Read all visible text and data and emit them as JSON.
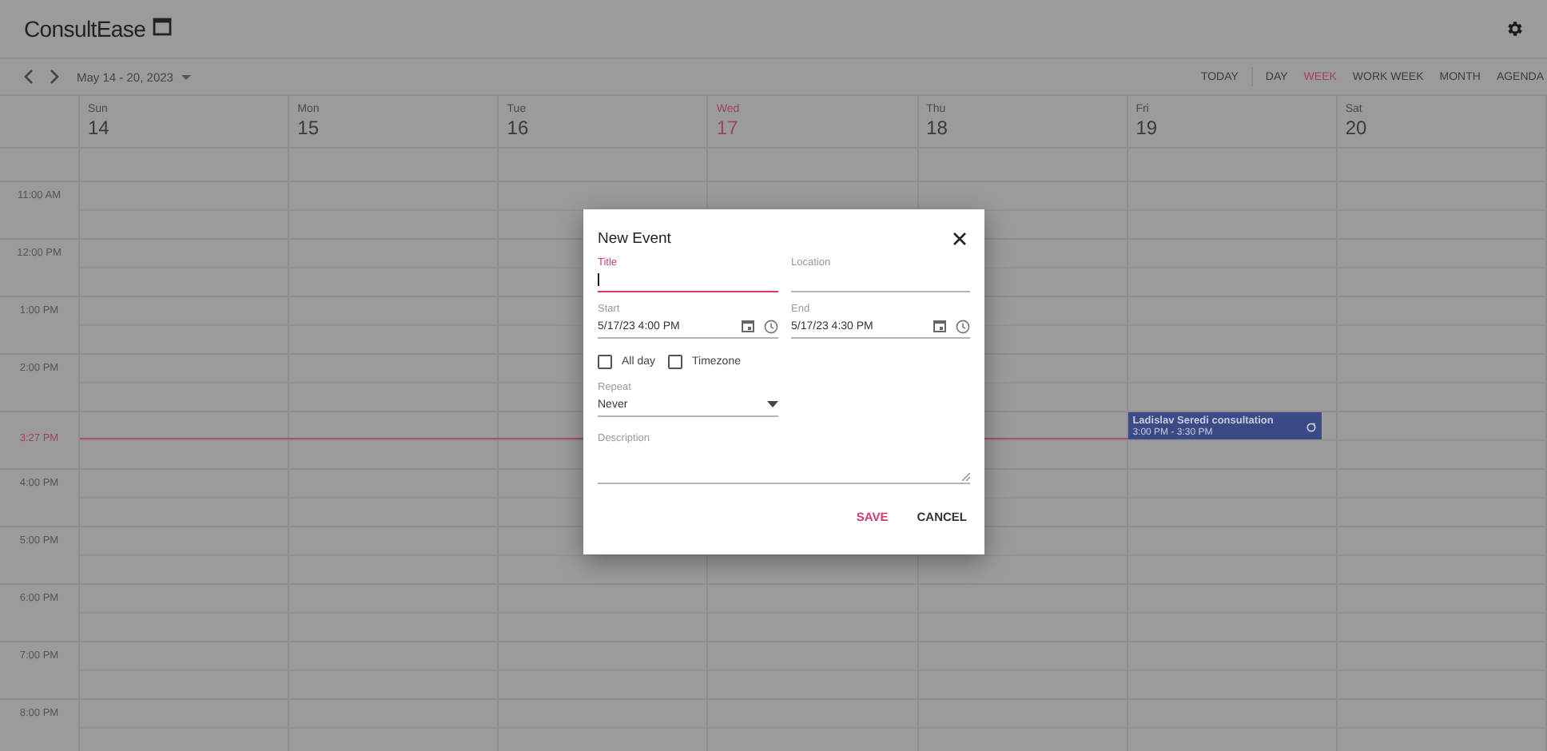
{
  "app": {
    "title": "ConsultEase"
  },
  "toolbar": {
    "range": "May 14 - 20, 2023",
    "today": "TODAY",
    "views": [
      {
        "label": "DAY",
        "selected": false
      },
      {
        "label": "WEEK",
        "selected": true
      },
      {
        "label": "WORK WEEK",
        "selected": false
      },
      {
        "label": "MONTH",
        "selected": false
      },
      {
        "label": "AGENDA",
        "selected": false
      }
    ]
  },
  "days": [
    {
      "name": "Sun",
      "date": "14",
      "today": false
    },
    {
      "name": "Mon",
      "date": "15",
      "today": false
    },
    {
      "name": "Tue",
      "date": "16",
      "today": false
    },
    {
      "name": "Wed",
      "date": "17",
      "today": true
    },
    {
      "name": "Thu",
      "date": "18",
      "today": false
    },
    {
      "name": "Fri",
      "date": "19",
      "today": false,
      "events": [
        {
          "title": "Ladislav Seredi consultation",
          "time": "3:00 PM - 3:30 PM"
        }
      ]
    },
    {
      "name": "Sat",
      "date": "20",
      "today": false
    }
  ],
  "time_rows": [
    {
      "label": "11:00 AM",
      "kind": "hour"
    },
    {
      "label": "12:00 PM",
      "kind": "hour"
    },
    {
      "label": "1:00 PM",
      "kind": "hour"
    },
    {
      "label": "2:00 PM",
      "kind": "hour"
    },
    {
      "label": "3:27 PM",
      "kind": "current"
    },
    {
      "label": "4:00 PM",
      "kind": "hour"
    },
    {
      "label": "5:00 PM",
      "kind": "hour"
    },
    {
      "label": "6:00 PM",
      "kind": "hour"
    },
    {
      "label": "7:00 PM",
      "kind": "hour"
    },
    {
      "label": "8:00 PM",
      "kind": "hour"
    }
  ],
  "dialog": {
    "title": "New Event",
    "title_field": {
      "label": "Title",
      "focused": true
    },
    "location_field": {
      "label": "Location",
      "focused": false
    },
    "start": {
      "label": "Start",
      "value": "5/17/23 4:00 PM"
    },
    "end": {
      "label": "End",
      "value": "5/17/23 4:30 PM"
    },
    "checkboxes": [
      {
        "label": "All day",
        "checked": false
      },
      {
        "label": "Timezone",
        "checked": false
      }
    ],
    "repeat": {
      "label": "Repeat",
      "value": "Never"
    },
    "description": {
      "label": "Description"
    },
    "buttons": [
      {
        "label": "SAVE",
        "kind": "primary"
      },
      {
        "label": "CANCEL",
        "kind": "secondary"
      }
    ]
  }
}
